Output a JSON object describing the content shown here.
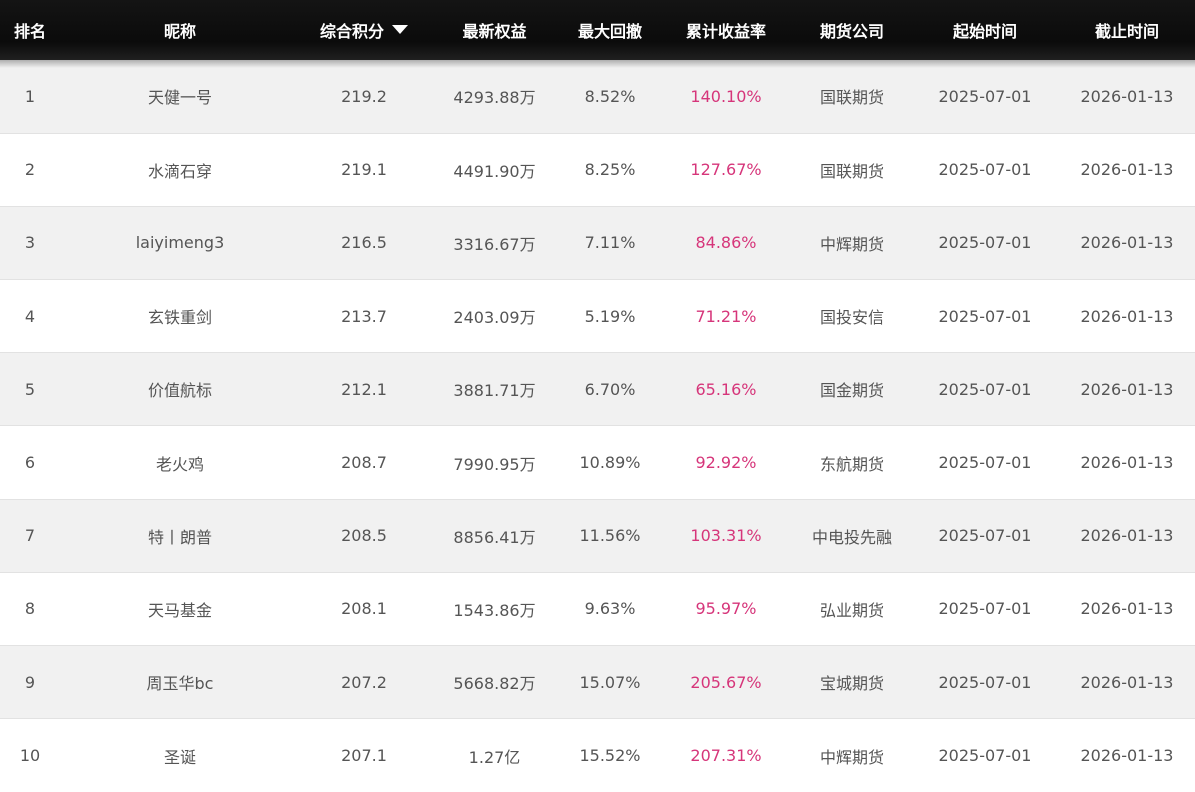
{
  "table": {
    "headers": {
      "rank": "排名",
      "nickname": "昵称",
      "score": "综合积分",
      "equity": "最新权益",
      "drawdown": "最大回撤",
      "return_rate": "累计收益率",
      "company": "期货公司",
      "start": "起始时间",
      "end": "截止时间"
    },
    "sort": {
      "column": "score",
      "direction": "desc",
      "icon": "sort-desc-triangle-icon"
    },
    "rows": [
      {
        "rank": "1",
        "nickname": "天健一号",
        "score": "219.2",
        "equity": "4293.88万",
        "drawdown": "8.52%",
        "return_rate": "140.10%",
        "company": "国联期货",
        "start": "2025-07-01",
        "end": "2026-01-13"
      },
      {
        "rank": "2",
        "nickname": "水滴石穿",
        "score": "219.1",
        "equity": "4491.90万",
        "drawdown": "8.25%",
        "return_rate": "127.67%",
        "company": "国联期货",
        "start": "2025-07-01",
        "end": "2026-01-13"
      },
      {
        "rank": "3",
        "nickname": "laiyimeng3",
        "score": "216.5",
        "equity": "3316.67万",
        "drawdown": "7.11%",
        "return_rate": "84.86%",
        "company": "中辉期货",
        "start": "2025-07-01",
        "end": "2026-01-13"
      },
      {
        "rank": "4",
        "nickname": "玄铁重剑",
        "score": "213.7",
        "equity": "2403.09万",
        "drawdown": "5.19%",
        "return_rate": "71.21%",
        "company": "国投安信",
        "start": "2025-07-01",
        "end": "2026-01-13"
      },
      {
        "rank": "5",
        "nickname": "价值航标",
        "score": "212.1",
        "equity": "3881.71万",
        "drawdown": "6.70%",
        "return_rate": "65.16%",
        "company": "国金期货",
        "start": "2025-07-01",
        "end": "2026-01-13"
      },
      {
        "rank": "6",
        "nickname": "老火鸡",
        "score": "208.7",
        "equity": "7990.95万",
        "drawdown": "10.89%",
        "return_rate": "92.92%",
        "company": "东航期货",
        "start": "2025-07-01",
        "end": "2026-01-13"
      },
      {
        "rank": "7",
        "nickname": "特丨朗普",
        "score": "208.5",
        "equity": "8856.41万",
        "drawdown": "11.56%",
        "return_rate": "103.31%",
        "company": "中电投先融",
        "start": "2025-07-01",
        "end": "2026-01-13"
      },
      {
        "rank": "8",
        "nickname": "天马基金",
        "score": "208.1",
        "equity": "1543.86万",
        "drawdown": "9.63%",
        "return_rate": "95.97%",
        "company": "弘业期货",
        "start": "2025-07-01",
        "end": "2026-01-13"
      },
      {
        "rank": "9",
        "nickname": "周玉华bc",
        "score": "207.2",
        "equity": "5668.82万",
        "drawdown": "15.07%",
        "return_rate": "205.67%",
        "company": "宝城期货",
        "start": "2025-07-01",
        "end": "2026-01-13"
      },
      {
        "rank": "10",
        "nickname": "圣诞",
        "score": "207.1",
        "equity": "1.27亿",
        "drawdown": "15.52%",
        "return_rate": "207.31%",
        "company": "中辉期货",
        "start": "2025-07-01",
        "end": "2026-01-13"
      }
    ]
  },
  "colors": {
    "header_bg": "#0b0b0b",
    "header_text": "#ffffff",
    "row_alt_bg": "#f1f1f1",
    "row_bg": "#ffffff",
    "text": "#555555",
    "return_accent": "#d6357a"
  }
}
